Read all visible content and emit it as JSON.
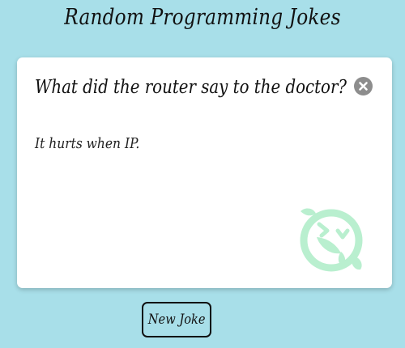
{
  "page": {
    "title": "Random Programming Jokes"
  },
  "joke": {
    "setup": "What did the router say to the doctor?",
    "punchline": "It hurts when IP."
  },
  "controls": {
    "close_icon": "close-icon",
    "new_joke_label": "New Joke"
  },
  "decor": {
    "icon": "laughing-face-icon",
    "icon_color": "#b9efcf"
  },
  "colors": {
    "background": "#a8dfe9",
    "card": "#ffffff",
    "close_button": "#8d8d8d"
  }
}
